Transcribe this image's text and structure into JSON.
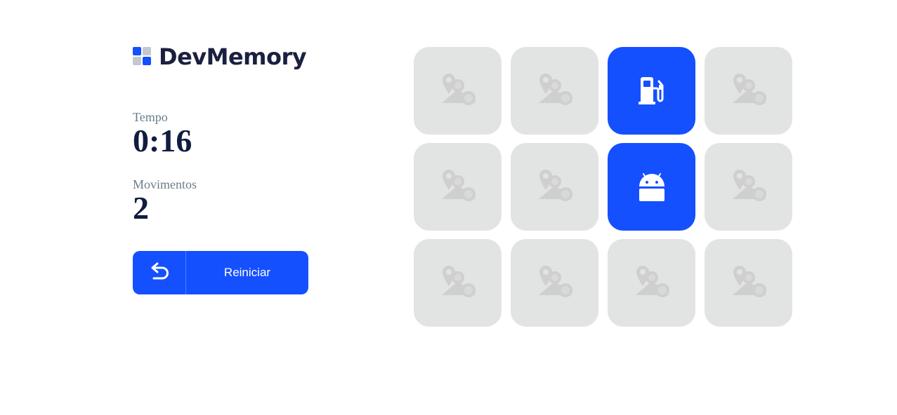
{
  "app": {
    "logo_text": "DevMemory"
  },
  "stats": {
    "time_label": "Tempo",
    "time_value": "0:16",
    "moves_label": "Movimentos",
    "moves_value": "2"
  },
  "restart": {
    "label": "Reiniciar",
    "icon": "undo-arrow-icon"
  },
  "colors": {
    "primary": "#1550ff",
    "card_hidden": "#e2e3e3",
    "card_placeholder_icon": "#cfcfcf",
    "logo_blue": "#1550ff",
    "logo_gray": "#c4c8cf"
  },
  "board": {
    "rows": 3,
    "columns": 4,
    "cards": [
      {
        "state": "hidden",
        "icon": "placeholder-icon"
      },
      {
        "state": "hidden",
        "icon": "placeholder-icon"
      },
      {
        "state": "revealed",
        "icon": "gas-station-icon"
      },
      {
        "state": "hidden",
        "icon": "placeholder-icon"
      },
      {
        "state": "hidden",
        "icon": "placeholder-icon"
      },
      {
        "state": "hidden",
        "icon": "placeholder-icon"
      },
      {
        "state": "revealed",
        "icon": "android-icon"
      },
      {
        "state": "hidden",
        "icon": "placeholder-icon"
      },
      {
        "state": "hidden",
        "icon": "placeholder-icon"
      },
      {
        "state": "hidden",
        "icon": "placeholder-icon"
      },
      {
        "state": "hidden",
        "icon": "placeholder-icon"
      },
      {
        "state": "hidden",
        "icon": "placeholder-icon"
      }
    ]
  }
}
